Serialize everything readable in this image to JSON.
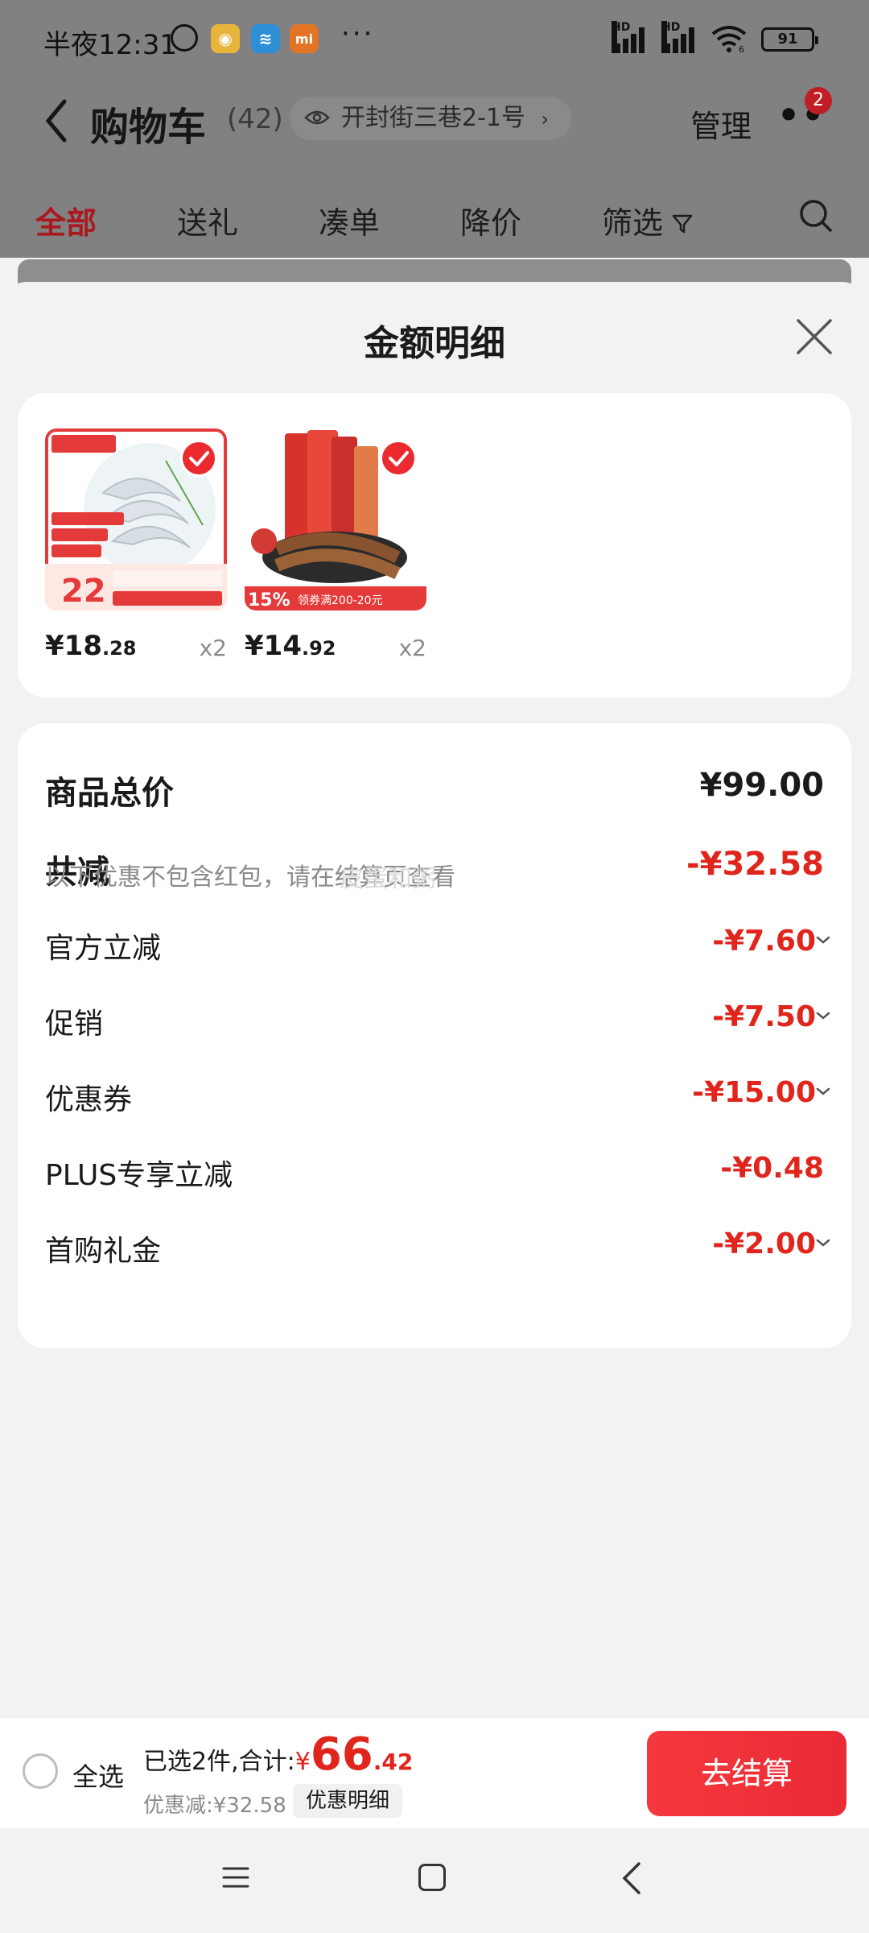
{
  "status_bar": {
    "time": "半夜12:31",
    "more": "···",
    "network_1": "HD",
    "network_2": "HD",
    "wifi_label": "6",
    "battery": "91"
  },
  "header": {
    "title": "购物车",
    "count": "(42)",
    "address": "开封街三巷2-1号",
    "address_chevron": "›",
    "manage": "管理",
    "more_badge": "2"
  },
  "tabs": [
    "全部",
    "送礼",
    "凑单",
    "降价",
    "筛选"
  ],
  "active_tab": "全部",
  "sheet": {
    "title": "金额明细",
    "products": [
      {
        "image": "shrimp-product-image",
        "price_int": "¥18",
        "price_dec": ".28",
        "qty": "x2",
        "promo_price": "22"
      },
      {
        "image": "cat-treat-product-image",
        "price_int": "¥14",
        "price_dec": ".92",
        "qty": "x2",
        "promo_badge": "15%",
        "coupon_text": "领券满200-20元"
      }
    ],
    "summary": {
      "total_label": "商品总价",
      "total_value": "¥99.00",
      "reduce_label": "共减",
      "reduce_value": "-¥32.58",
      "note": "以下优惠不包含红包，请在结算页查看",
      "watermark": "皮蛋和粥"
    },
    "items": [
      {
        "label": "官方立减",
        "value": "-¥7.60",
        "expandable": true
      },
      {
        "label": "促销",
        "value": "-¥7.50",
        "expandable": true
      },
      {
        "label": "优惠券",
        "value": "-¥15.00",
        "expandable": true
      },
      {
        "label": "PLUS专享立减",
        "value": "-¥0.48",
        "expandable": false
      },
      {
        "label": "首购礼金",
        "value": "-¥2.00",
        "expandable": true
      }
    ]
  },
  "bottom_bar": {
    "select_all": "全选",
    "selected_text": "已选2件,合计:",
    "currency": "¥",
    "total_int": "66",
    "total_dec": ".42",
    "discount_text": "优惠减:¥32.58",
    "detail_chip": "优惠明细",
    "checkout": "去结算"
  },
  "colors": {
    "accent_red": "#e0251c",
    "checkout_red": "#f5383d",
    "overlay_gray": "#818181",
    "sheet_bg": "#f2f2f4"
  }
}
